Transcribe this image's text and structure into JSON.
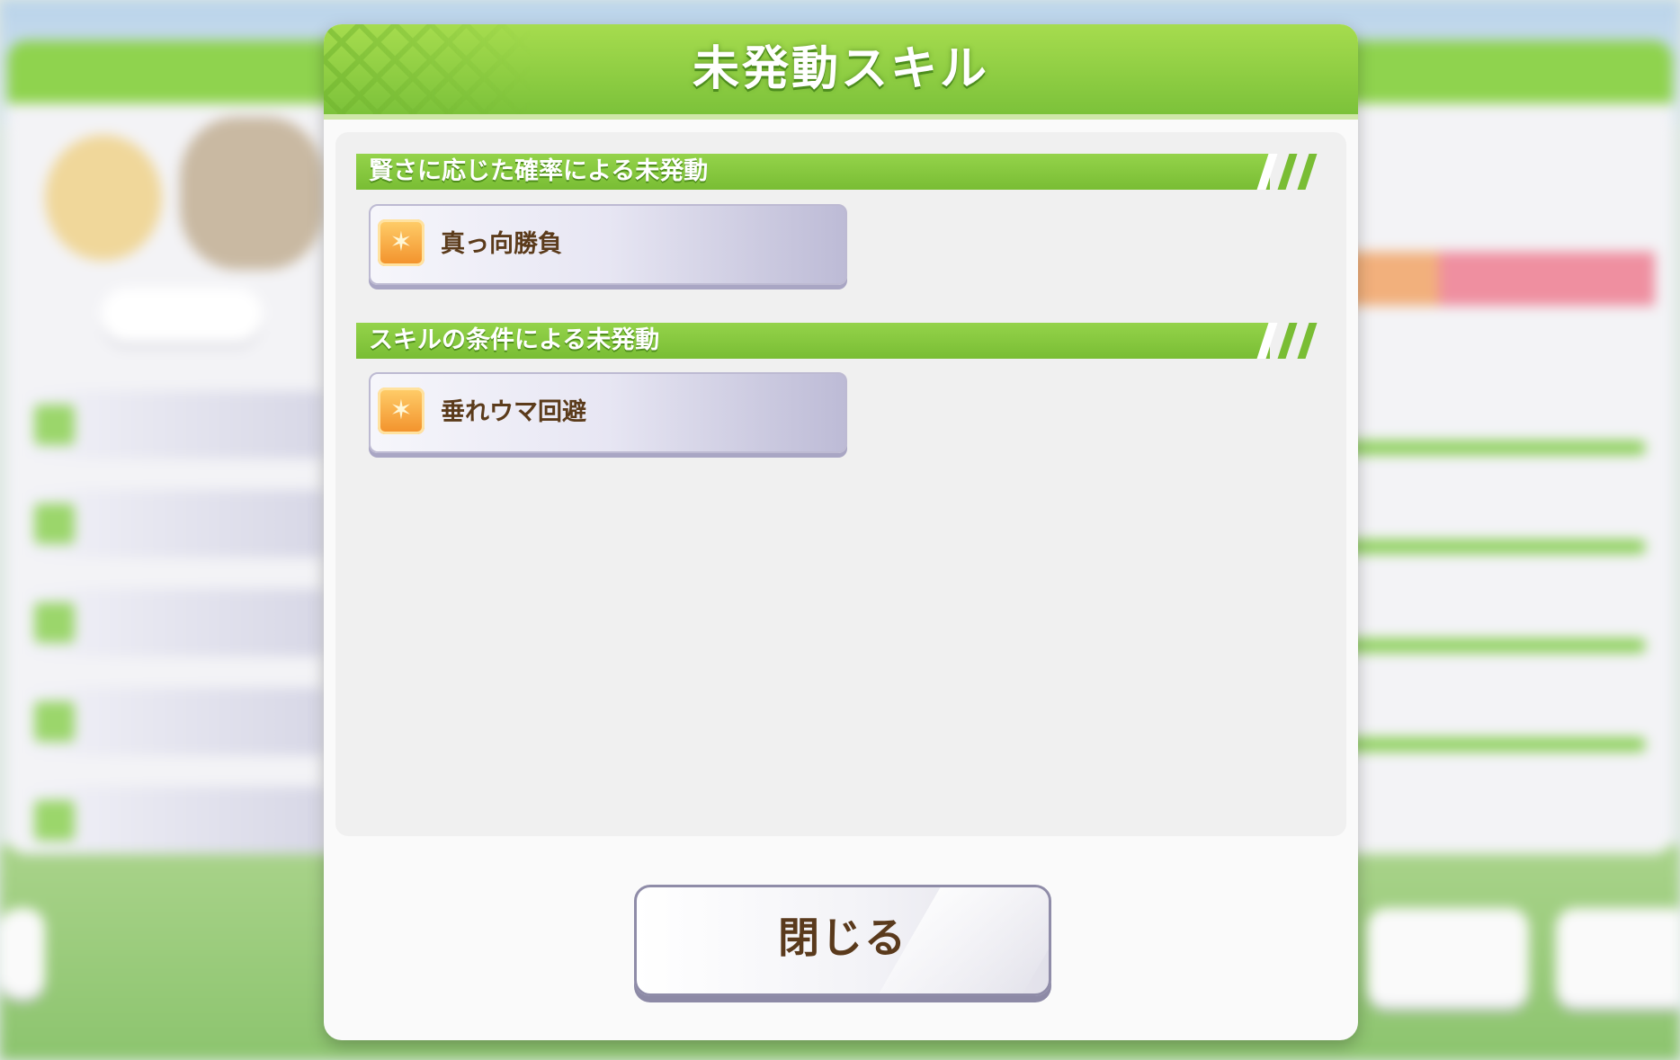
{
  "dialog": {
    "title": "未発動スキル",
    "sections": [
      {
        "heading": "賢さに応じた確率による未発動",
        "skills": [
          {
            "name": "真っ向勝負",
            "icon": "speed-skill-icon"
          }
        ]
      },
      {
        "heading": "スキルの条件による未発動",
        "skills": [
          {
            "name": "垂れウマ回避",
            "icon": "speed-skill-icon"
          }
        ]
      }
    ],
    "close_label": "閉じる"
  },
  "colors": {
    "header_green": "#7cc23a",
    "section_green": "#79bd34",
    "skill_text": "#5b3b1b",
    "skill_icon_orange": "#f2902a"
  }
}
